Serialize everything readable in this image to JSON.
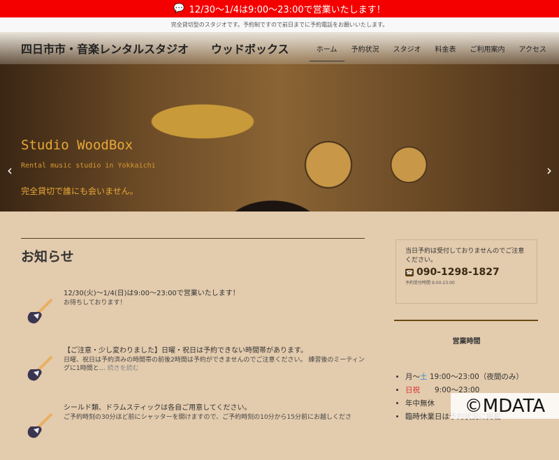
{
  "announcement": "12/30〜1/4は9:00〜23:00で営業いたします！",
  "subheader": "完全貸切型のスタジオです。予約制ですので前日までに予約電話をお願いいたします。",
  "logo": "四日市市・音楽レンタルスタジオ　　ウッドボックス",
  "menu": [
    "ホーム",
    "予約状況",
    "スタジオ",
    "料金表",
    "ご利用案内",
    "アクセス"
  ],
  "hero": {
    "title": "Studio WoodBox",
    "subtitle": "Rental music studio in Yokkaichi",
    "tagline": "完全貸切で誰にも会いません。",
    "prev": "‹",
    "next": "›"
  },
  "news": {
    "heading": "お知らせ",
    "items": [
      {
        "title": "12/30(火)〜1/4(日)は9:00〜23:00で営業いたします！",
        "body": "お待ちしております！",
        "more": ""
      },
      {
        "title": "【ご注意・少し変わりました】日曜・祝日は予約できない時間帯があります。",
        "body": "日曜、祝日は予約済みの時間帯の前後2時間は予約ができませんのでご注意ください。 練習後のミーティングに1時間と…",
        "more": "続きを読む"
      },
      {
        "title": "シールド類、ドラムスティックは各自ご用意してください。",
        "body": "ご予約時刻の30分ほど前にシャッターを開けますので、ご予約時刻の10分から15分前にお越しくださ",
        "more": ""
      }
    ]
  },
  "sidebar": {
    "notice": "当日予約は受付しておりませんのでご注意ください。",
    "phone": "090-1298-1827",
    "phone_hours": "予約受付時間 9:00-23:00",
    "hours_heading": "営業時間",
    "hours": [
      {
        "a": "月〜",
        "b": "土",
        "c": " 19:00〜23:00（夜間のみ）"
      },
      {
        "a": "",
        "b": "日祝",
        "c": "　　9:00〜23:00"
      },
      {
        "a": "年中無休",
        "b": "",
        "c": ""
      },
      {
        "a": "臨時休業日は",
        "b": "",
        "c": "予約状況に掲載"
      }
    ]
  },
  "watermark": "©MDATA"
}
